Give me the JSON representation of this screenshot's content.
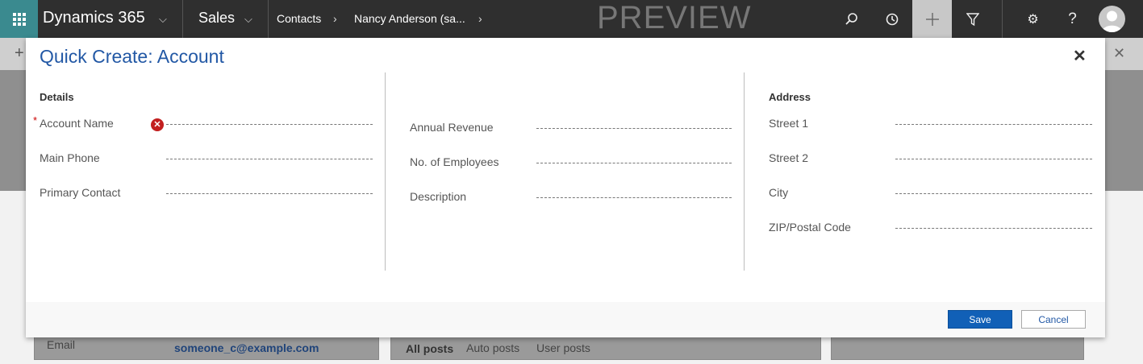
{
  "topbar": {
    "app_name": "Dynamics 365",
    "module": "Sales",
    "breadcrumb": [
      "Contacts",
      "Nancy Anderson (sa..."
    ],
    "watermark": "PREVIEW",
    "icons": [
      "search-icon",
      "history-icon",
      "plus-icon",
      "filter-icon",
      "gear-icon",
      "help-icon",
      "avatar-icon"
    ]
  },
  "background": {
    "email_label": "Email",
    "email_value": "someone_c@example.com",
    "post_tabs": [
      "All posts",
      "Auto posts",
      "User posts"
    ]
  },
  "dialog": {
    "title": "Quick Create: Account",
    "close_glyph": "✕",
    "columns": [
      {
        "section": "Details",
        "fields": [
          {
            "label": "Account Name",
            "required": true,
            "error": true,
            "value": ""
          },
          {
            "label": "Main Phone",
            "value": ""
          },
          {
            "label": "Primary Contact",
            "value": ""
          }
        ]
      },
      {
        "section": "",
        "fields": [
          {
            "label": "Annual Revenue",
            "value": ""
          },
          {
            "label": "No. of Employees",
            "value": ""
          },
          {
            "label": "Description",
            "value": ""
          }
        ]
      },
      {
        "section": "Address",
        "fields": [
          {
            "label": "Street 1",
            "value": ""
          },
          {
            "label": "Street 2",
            "value": ""
          },
          {
            "label": "City",
            "value": ""
          },
          {
            "label": "ZIP/Postal Code",
            "value": ""
          }
        ]
      }
    ],
    "required_marker": "*",
    "buttons": {
      "save": "Save",
      "cancel": "Cancel"
    }
  },
  "colors": {
    "topbar": "#2f2f2f",
    "waffle": "#3a8a8f",
    "title": "#2258a5",
    "save_button": "#1160b7",
    "error": "#c21f1f"
  }
}
